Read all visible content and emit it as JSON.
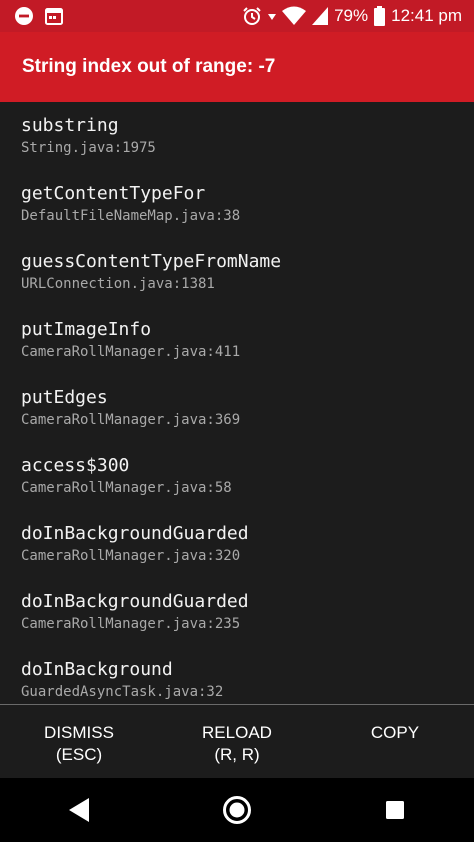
{
  "status_bar": {
    "battery": "79%",
    "time": "12:41 pm",
    "icons": [
      "do-not-disturb-icon",
      "calendar-icon",
      "alarm-icon",
      "wifi-icon",
      "signal-icon",
      "battery-icon"
    ]
  },
  "error": {
    "title": "String index out of range: -7"
  },
  "stack_frames": [
    {
      "method": "substring",
      "file": "String.java:1975"
    },
    {
      "method": "getContentTypeFor",
      "file": "DefaultFileNameMap.java:38"
    },
    {
      "method": "guessContentTypeFromName",
      "file": "URLConnection.java:1381"
    },
    {
      "method": "putImageInfo",
      "file": "CameraRollManager.java:411"
    },
    {
      "method": "putEdges",
      "file": "CameraRollManager.java:369"
    },
    {
      "method": "access$300",
      "file": "CameraRollManager.java:58"
    },
    {
      "method": "doInBackgroundGuarded",
      "file": "CameraRollManager.java:320"
    },
    {
      "method": "doInBackgroundGuarded",
      "file": "CameraRollManager.java:235"
    },
    {
      "method": "doInBackground",
      "file": "GuardedAsyncTask.java:32"
    }
  ],
  "actions": {
    "dismiss": {
      "line1": "DISMISS",
      "line2": "(ESC)"
    },
    "reload": {
      "line1": "RELOAD",
      "line2": "(R, R)"
    },
    "copy": {
      "line1": "COPY"
    }
  },
  "colors": {
    "status_bar": "#c21a26",
    "header": "#d01c25",
    "background": "#1c1c1c",
    "nav_bar": "#000000"
  }
}
